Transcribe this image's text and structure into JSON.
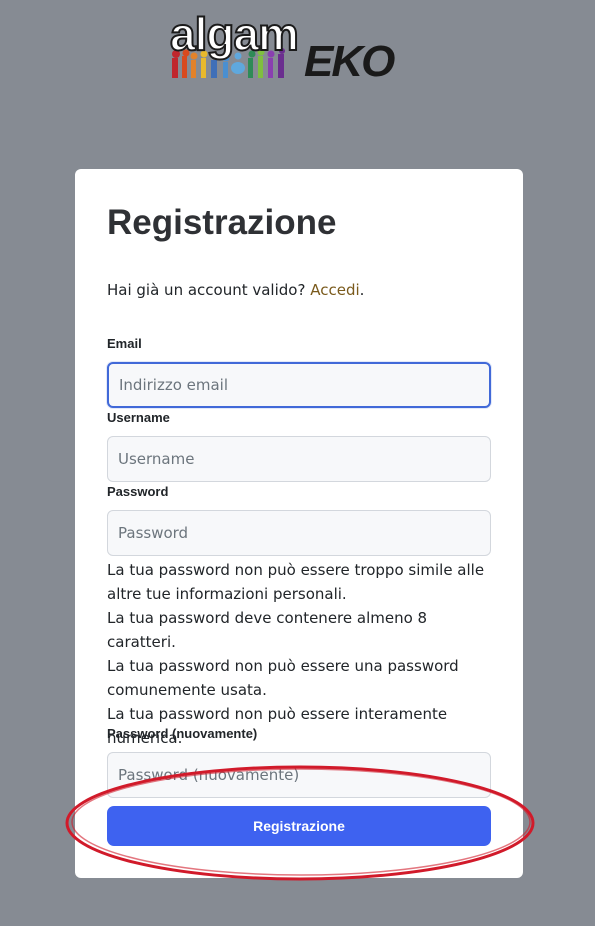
{
  "logo": {
    "word1": "algam",
    "word2": "EKO"
  },
  "card": {
    "title": "Registrazione",
    "account_prompt": "Hai già un account valido?",
    "login_link": "Accedi",
    "login_suffix": "."
  },
  "fields": {
    "email": {
      "label": "Email",
      "placeholder": "Indirizzo email"
    },
    "username": {
      "label": "Username",
      "placeholder": "Username"
    },
    "password": {
      "label": "Password",
      "placeholder": "Password"
    },
    "password2": {
      "label": "Password (nuovamente)",
      "placeholder": "Password (nuovamente)"
    }
  },
  "password_help": [
    "La tua password non può essere troppo simile alle altre tue informazioni personali.",
    "La tua password deve contenere almeno 8 caratteri.",
    "La tua password non può essere una password comunemente usata.",
    "La tua password non può essere interamente numerica."
  ],
  "submit_label": "Registrazione",
  "colors": {
    "background": "#868b93",
    "button": "#3e62f0",
    "link": "#7a5a1c",
    "annotation": "#d11a2a"
  }
}
